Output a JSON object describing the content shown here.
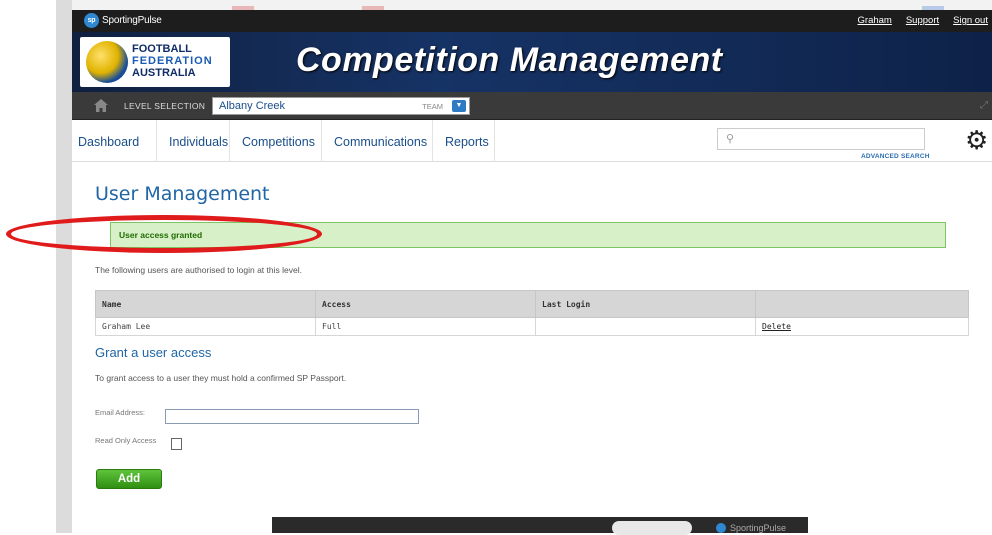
{
  "sp_bar": {
    "brand": "SportingPulse",
    "links": [
      "Graham",
      "Support",
      "Sign out"
    ]
  },
  "banner": {
    "org_line1": "FOOTBALL",
    "org_line2": "FEDERATION",
    "org_line3": "AUSTRALIA",
    "title": "Competition Management"
  },
  "level_bar": {
    "label": "LEVEL SELECTION",
    "value": "Albany Creek",
    "type": "TEAM"
  },
  "nav": {
    "items": [
      "Dashboard",
      "Individuals",
      "Competitions",
      "Communications",
      "Reports"
    ],
    "advanced_search": "ADVANCED SEARCH"
  },
  "page": {
    "title": "User Management",
    "alert": "User access granted",
    "intro": "The following users are authorised to login at this level."
  },
  "users_table": {
    "headers": [
      "Name",
      "Access",
      "Last Login",
      ""
    ],
    "rows": [
      {
        "name": "Graham Lee",
        "access": "Full",
        "last_login": "",
        "action": "Delete"
      }
    ]
  },
  "grant": {
    "title": "Grant a user access",
    "note": "To grant access to a user they must hold a confirmed SP Passport.",
    "email_label": "Email Address:",
    "email_value": "",
    "readonly_label": "Read Only Access",
    "add_label": "Add"
  },
  "bottom_frame": {
    "brand": "SportingPulse"
  },
  "colors": {
    "accent": "#2066a6",
    "alert_bg": "#d7f0c8",
    "add_button": "#3fa31f",
    "annotation": "#e01b1b"
  }
}
